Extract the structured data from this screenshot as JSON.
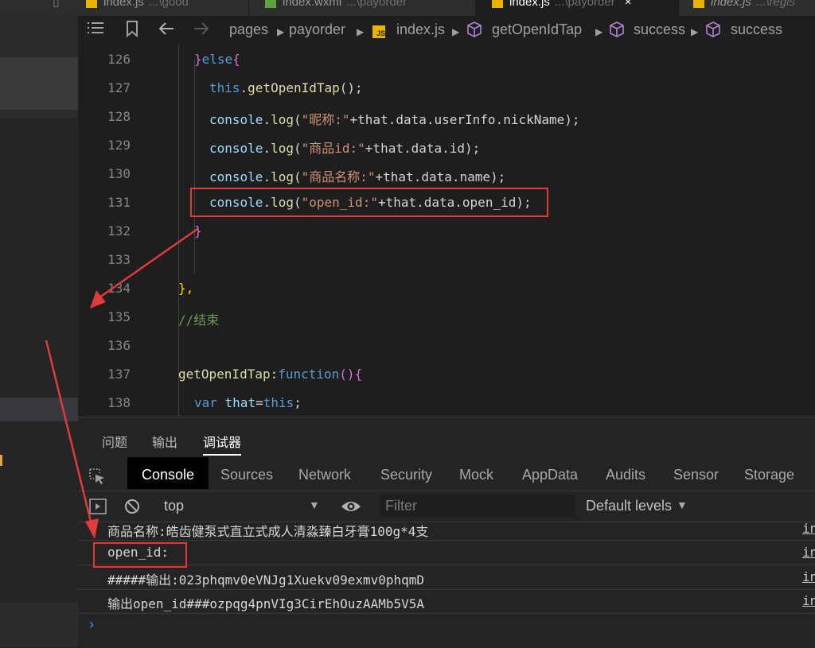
{
  "tabs": [
    {
      "name": "index.js",
      "path": "...\\good"
    },
    {
      "name": "index.wxml",
      "path": "...\\payorder"
    },
    {
      "name": "index.js",
      "path": "...\\payorder",
      "close": "×"
    },
    {
      "name": "index.js",
      "path": "...\\regis"
    }
  ],
  "breadcrumb": [
    "pages",
    "payorder",
    "index.js",
    "getOpenIdTap",
    "success",
    "success"
  ],
  "editor": {
    "line_numbers": [
      "126",
      "127",
      "128",
      "129",
      "130",
      "131",
      "132",
      "133",
      "134",
      "135",
      "136",
      "137",
      "138"
    ],
    "lines": {
      "l126": {
        "b1": "}",
        "kw": "else",
        "b2": "{"
      },
      "l127": {
        "obj": "this",
        "dot": ".",
        "fn": "getOpenIdTap",
        "tail": "();"
      },
      "l128": {
        "obj": "console",
        "dot": ".",
        "fn": "log",
        "open": "(",
        "str": "\"昵称:\"",
        "rest": "+that.data.userInfo.nickName",
        "close": ");"
      },
      "l129": {
        "obj": "console",
        "dot": ".",
        "fn": "log",
        "open": "(",
        "str": "\"商品id:\"",
        "rest": "+that.data.id",
        "close": ");"
      },
      "l130": {
        "obj": "console",
        "dot": ".",
        "fn": "log",
        "open": "(",
        "str": "\"商品名称:\"",
        "rest": "+that.data.name",
        "close": ");"
      },
      "l131": {
        "obj": "console",
        "dot": ".",
        "fn": "log",
        "open": "(",
        "str": "\"open_id:\"",
        "rest": "+that.data.open_id",
        "close": ");"
      },
      "l132": {
        "b": "}"
      },
      "l134": {
        "b": "},"
      },
      "l135": {
        "comment": "//结束"
      },
      "l137": {
        "fn": "getOpenIdTap",
        "colon": ":",
        "kw": "function",
        "tail": "(){"
      },
      "l138": {
        "kw": "var",
        "name": " that",
        "eq": "=",
        "kw2": "this",
        "semi": ";"
      }
    }
  },
  "panel": {
    "tabs": [
      "问题",
      "输出",
      "调试器"
    ],
    "active_tab": "调试器",
    "devtools_tabs": [
      "Console",
      "Sources",
      "Network",
      "Security",
      "Mock",
      "AppData",
      "Audits",
      "Sensor",
      "Storage"
    ],
    "active_devtools_tab": "Console",
    "context": "top",
    "filter_placeholder": "Filter",
    "levels": "Default levels",
    "logs": [
      {
        "text": "商品名称:皓齿健泵式直立式成人清淼臻白牙膏100g*4支",
        "source": "in"
      },
      {
        "text": "open_id:",
        "source": "in"
      },
      {
        "text": "#####输出:023phqmv0eVNJg1Xuekv09exmv0phqmD",
        "source": "in"
      },
      {
        "text": "输出open_id###ozpqg4pnVIg3CirEhOuzAAMb5V5A",
        "source": "in"
      }
    ],
    "prompt": "›"
  },
  "colors": {
    "annotation_red": "#e03a3a",
    "editor_bg": "#1e1e1e",
    "panel_bg": "#242424",
    "js_badge": "#e8b400"
  }
}
